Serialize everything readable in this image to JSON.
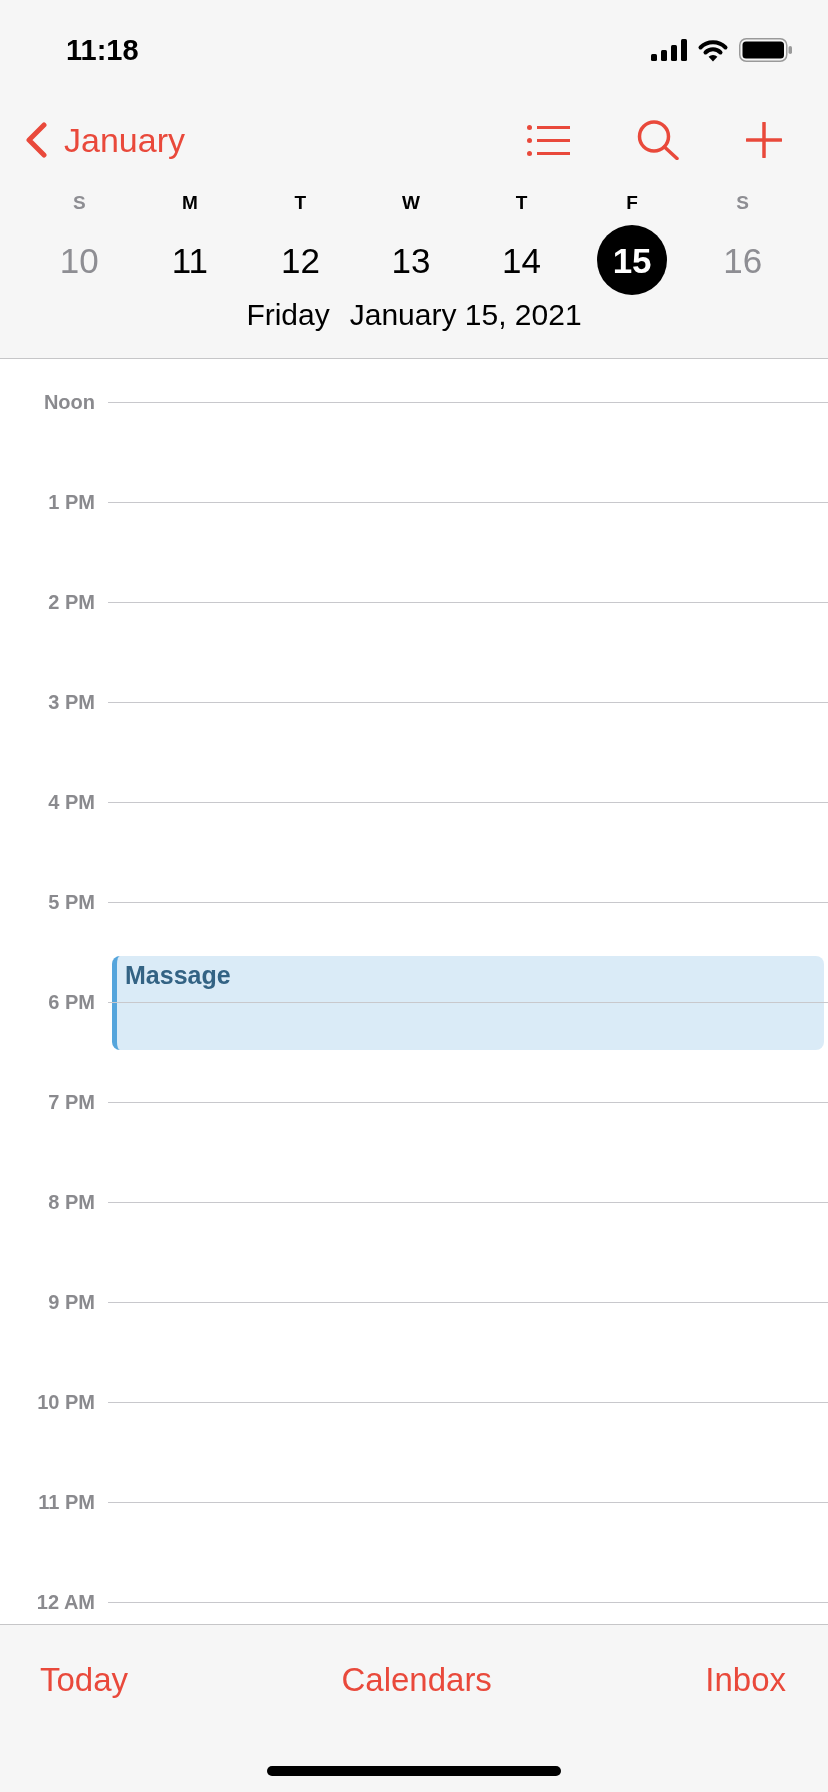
{
  "status_bar": {
    "time": "11:18"
  },
  "nav": {
    "back_label": "January"
  },
  "week": {
    "days": [
      {
        "letter": "S",
        "date": "10",
        "dimmed": true,
        "selected": false
      },
      {
        "letter": "M",
        "date": "11",
        "dimmed": false,
        "selected": false
      },
      {
        "letter": "T",
        "date": "12",
        "dimmed": false,
        "selected": false
      },
      {
        "letter": "W",
        "date": "13",
        "dimmed": false,
        "selected": false
      },
      {
        "letter": "T",
        "date": "14",
        "dimmed": false,
        "selected": false
      },
      {
        "letter": "F",
        "date": "15",
        "dimmed": false,
        "selected": true
      },
      {
        "letter": "S",
        "date": "16",
        "dimmed": true,
        "selected": false
      }
    ]
  },
  "selected_date": {
    "weekday": "Friday",
    "date": "January 15, 2021"
  },
  "timeline": {
    "hours": [
      {
        "label": "Noon"
      },
      {
        "label": "1 PM"
      },
      {
        "label": "2 PM"
      },
      {
        "label": "3 PM"
      },
      {
        "label": "4 PM"
      },
      {
        "label": "5 PM",
        "events": [
          {
            "title": "Massage",
            "color": "#55a5dc"
          }
        ]
      },
      {
        "label": "6 PM"
      },
      {
        "label": "7 PM"
      },
      {
        "label": "8 PM"
      },
      {
        "label": "9 PM"
      },
      {
        "label": "10 PM"
      },
      {
        "label": "11 PM"
      },
      {
        "label": "12 AM"
      }
    ]
  },
  "toolbar": {
    "items": [
      "Today",
      "Calendars",
      "Inbox"
    ]
  }
}
